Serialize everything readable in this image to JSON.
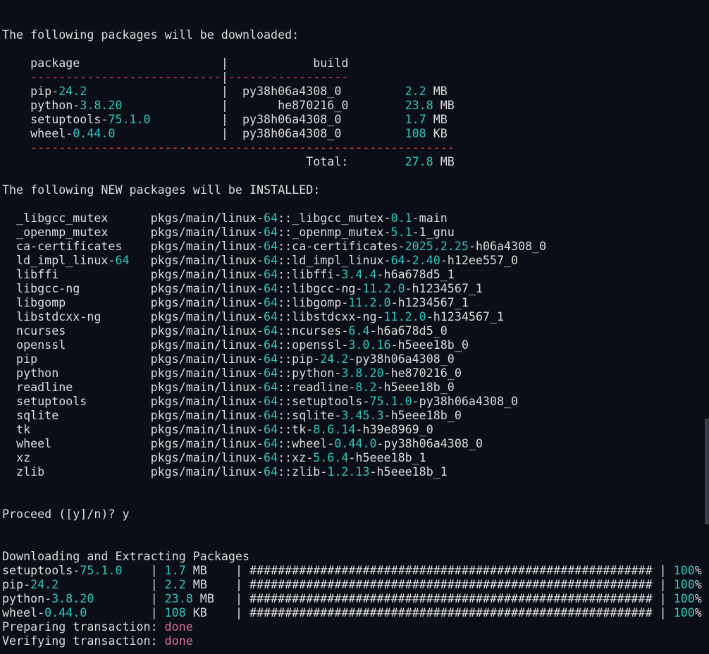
{
  "colors": {
    "background": "#0c0e17",
    "text": "#dcdcdc",
    "cyan": "#2cc7bd",
    "red": "#e2424a",
    "pink": "#d7729b",
    "scrollbar": "#3b3e48"
  },
  "lines": [
    [
      [
        "t",
        "The following packages will be downloaded:"
      ]
    ],
    [],
    [
      [
        "t",
        "    package                    |            build"
      ]
    ],
    [
      [
        "r",
        "    ---------------------------"
      ],
      [
        "t",
        "|"
      ],
      [
        "r",
        "-----------------"
      ]
    ],
    [
      [
        "t",
        "    pip-"
      ],
      [
        "c",
        "24.2"
      ],
      [
        "t",
        "                   |  py38h06a4308_0         "
      ],
      [
        "c",
        "2.2"
      ],
      [
        "t",
        " MB"
      ]
    ],
    [
      [
        "t",
        "    python-"
      ],
      [
        "c",
        "3.8.20"
      ],
      [
        "t",
        "              |       he870216_0        "
      ],
      [
        "c",
        "23.8"
      ],
      [
        "t",
        " MB"
      ]
    ],
    [
      [
        "t",
        "    setuptools-"
      ],
      [
        "c",
        "75.1.0"
      ],
      [
        "t",
        "          |  py38h06a4308_0         "
      ],
      [
        "c",
        "1.7"
      ],
      [
        "t",
        " MB"
      ]
    ],
    [
      [
        "t",
        "    wheel-"
      ],
      [
        "c",
        "0.44.0"
      ],
      [
        "t",
        "               |  py38h06a4308_0         "
      ],
      [
        "c",
        "108"
      ],
      [
        "t",
        " KB"
      ]
    ],
    [
      [
        "r",
        "    ------------------------------------------------------------"
      ]
    ],
    [
      [
        "t",
        "                                           Total:        "
      ],
      [
        "c",
        "27.8"
      ],
      [
        "t",
        " MB"
      ]
    ],
    [],
    [
      [
        "t",
        "The following NEW packages will be INSTALLED:"
      ]
    ],
    [],
    [
      [
        "t",
        "  _libgcc_mutex      pkgs/main/linux-"
      ],
      [
        "c",
        "64"
      ],
      [
        "t",
        "::_libgcc_mutex-"
      ],
      [
        "c",
        "0.1"
      ],
      [
        "t",
        "-main"
      ]
    ],
    [
      [
        "t",
        "  _openmp_mutex      pkgs/main/linux-"
      ],
      [
        "c",
        "64"
      ],
      [
        "t",
        "::_openmp_mutex-"
      ],
      [
        "c",
        "5.1"
      ],
      [
        "t",
        "-1_gnu"
      ]
    ],
    [
      [
        "t",
        "  ca-certificates    pkgs/main/linux-"
      ],
      [
        "c",
        "64"
      ],
      [
        "t",
        "::ca-certificates-"
      ],
      [
        "c",
        "2025.2.25"
      ],
      [
        "t",
        "-h06a4308_0"
      ]
    ],
    [
      [
        "t",
        "  ld_impl_linux-"
      ],
      [
        "c",
        "64"
      ],
      [
        "t",
        "   pkgs/main/linux-"
      ],
      [
        "c",
        "64"
      ],
      [
        "t",
        "::ld_impl_linux-"
      ],
      [
        "c",
        "64"
      ],
      [
        "t",
        "-"
      ],
      [
        "c",
        "2.40"
      ],
      [
        "t",
        "-h12ee557_0"
      ]
    ],
    [
      [
        "t",
        "  libffi             pkgs/main/linux-"
      ],
      [
        "c",
        "64"
      ],
      [
        "t",
        "::libffi-"
      ],
      [
        "c",
        "3.4.4"
      ],
      [
        "t",
        "-h6a678d5_1"
      ]
    ],
    [
      [
        "t",
        "  libgcc-ng          pkgs/main/linux-"
      ],
      [
        "c",
        "64"
      ],
      [
        "t",
        "::libgcc-ng-"
      ],
      [
        "c",
        "11.2.0"
      ],
      [
        "t",
        "-h1234567_1"
      ]
    ],
    [
      [
        "t",
        "  libgomp            pkgs/main/linux-"
      ],
      [
        "c",
        "64"
      ],
      [
        "t",
        "::libgomp-"
      ],
      [
        "c",
        "11.2.0"
      ],
      [
        "t",
        "-h1234567_1"
      ]
    ],
    [
      [
        "t",
        "  libstdcxx-ng       pkgs/main/linux-"
      ],
      [
        "c",
        "64"
      ],
      [
        "t",
        "::libstdcxx-ng-"
      ],
      [
        "c",
        "11.2.0"
      ],
      [
        "t",
        "-h1234567_1"
      ]
    ],
    [
      [
        "t",
        "  ncurses            pkgs/main/linux-"
      ],
      [
        "c",
        "64"
      ],
      [
        "t",
        "::ncurses-"
      ],
      [
        "c",
        "6.4"
      ],
      [
        "t",
        "-h6a678d5_0"
      ]
    ],
    [
      [
        "t",
        "  openssl            pkgs/main/linux-"
      ],
      [
        "c",
        "64"
      ],
      [
        "t",
        "::openssl-"
      ],
      [
        "c",
        "3.0.16"
      ],
      [
        "t",
        "-h5eee18b_0"
      ]
    ],
    [
      [
        "t",
        "  pip                pkgs/main/linux-"
      ],
      [
        "c",
        "64"
      ],
      [
        "t",
        "::pip-"
      ],
      [
        "c",
        "24.2"
      ],
      [
        "t",
        "-py38h06a4308_0"
      ]
    ],
    [
      [
        "t",
        "  python             pkgs/main/linux-"
      ],
      [
        "c",
        "64"
      ],
      [
        "t",
        "::python-"
      ],
      [
        "c",
        "3.8.20"
      ],
      [
        "t",
        "-he870216_0"
      ]
    ],
    [
      [
        "t",
        "  readline           pkgs/main/linux-"
      ],
      [
        "c",
        "64"
      ],
      [
        "t",
        "::readline-"
      ],
      [
        "c",
        "8.2"
      ],
      [
        "t",
        "-h5eee18b_0"
      ]
    ],
    [
      [
        "t",
        "  setuptools         pkgs/main/linux-"
      ],
      [
        "c",
        "64"
      ],
      [
        "t",
        "::setuptools-"
      ],
      [
        "c",
        "75.1.0"
      ],
      [
        "t",
        "-py38h06a4308_0"
      ]
    ],
    [
      [
        "t",
        "  sqlite             pkgs/main/linux-"
      ],
      [
        "c",
        "64"
      ],
      [
        "t",
        "::sqlite-"
      ],
      [
        "c",
        "3.45.3"
      ],
      [
        "t",
        "-h5eee18b_0"
      ]
    ],
    [
      [
        "t",
        "  tk                 pkgs/main/linux-"
      ],
      [
        "c",
        "64"
      ],
      [
        "t",
        "::tk-"
      ],
      [
        "c",
        "8.6.14"
      ],
      [
        "t",
        "-h39e8969_0"
      ]
    ],
    [
      [
        "t",
        "  wheel              pkgs/main/linux-"
      ],
      [
        "c",
        "64"
      ],
      [
        "t",
        "::wheel-"
      ],
      [
        "c",
        "0.44.0"
      ],
      [
        "t",
        "-py38h06a4308_0"
      ]
    ],
    [
      [
        "t",
        "  xz                 pkgs/main/linux-"
      ],
      [
        "c",
        "64"
      ],
      [
        "t",
        "::xz-"
      ],
      [
        "c",
        "5.6.4"
      ],
      [
        "t",
        "-h5eee18b_1"
      ]
    ],
    [
      [
        "t",
        "  zlib               pkgs/main/linux-"
      ],
      [
        "c",
        "64"
      ],
      [
        "t",
        "::zlib-"
      ],
      [
        "c",
        "1.2.13"
      ],
      [
        "t",
        "-h5eee18b_1"
      ]
    ],
    [],
    [],
    [
      [
        "t",
        "Proceed ([y]/n)? y"
      ]
    ],
    [],
    [],
    [
      [
        "t",
        "Downloading and Extracting Packages"
      ]
    ],
    [
      [
        "t",
        "setuptools-"
      ],
      [
        "c",
        "75.1.0"
      ],
      [
        "t",
        "    | "
      ],
      [
        "c",
        "1.7"
      ],
      [
        "t",
        " MB    | ######################################################### | "
      ],
      [
        "c",
        "100"
      ],
      [
        "t",
        "%"
      ]
    ],
    [
      [
        "t",
        "pip-"
      ],
      [
        "c",
        "24.2"
      ],
      [
        "t",
        "             | "
      ],
      [
        "c",
        "2.2"
      ],
      [
        "t",
        " MB    | ######################################################### | "
      ],
      [
        "c",
        "100"
      ],
      [
        "t",
        "%"
      ]
    ],
    [
      [
        "t",
        "python-"
      ],
      [
        "c",
        "3.8.20"
      ],
      [
        "t",
        "        | "
      ],
      [
        "c",
        "23.8"
      ],
      [
        "t",
        " MB   | ######################################################### | "
      ],
      [
        "c",
        "100"
      ],
      [
        "t",
        "%"
      ]
    ],
    [
      [
        "t",
        "wheel-"
      ],
      [
        "c",
        "0.44.0"
      ],
      [
        "t",
        "         | "
      ],
      [
        "c",
        "108"
      ],
      [
        "t",
        " KB    | ######################################################### | "
      ],
      [
        "c",
        "100"
      ],
      [
        "t",
        "%"
      ]
    ],
    [
      [
        "t",
        "Preparing transaction: "
      ],
      [
        "p",
        "done"
      ]
    ],
    [
      [
        "t",
        "Verifying transaction: "
      ],
      [
        "p",
        "done"
      ]
    ]
  ]
}
